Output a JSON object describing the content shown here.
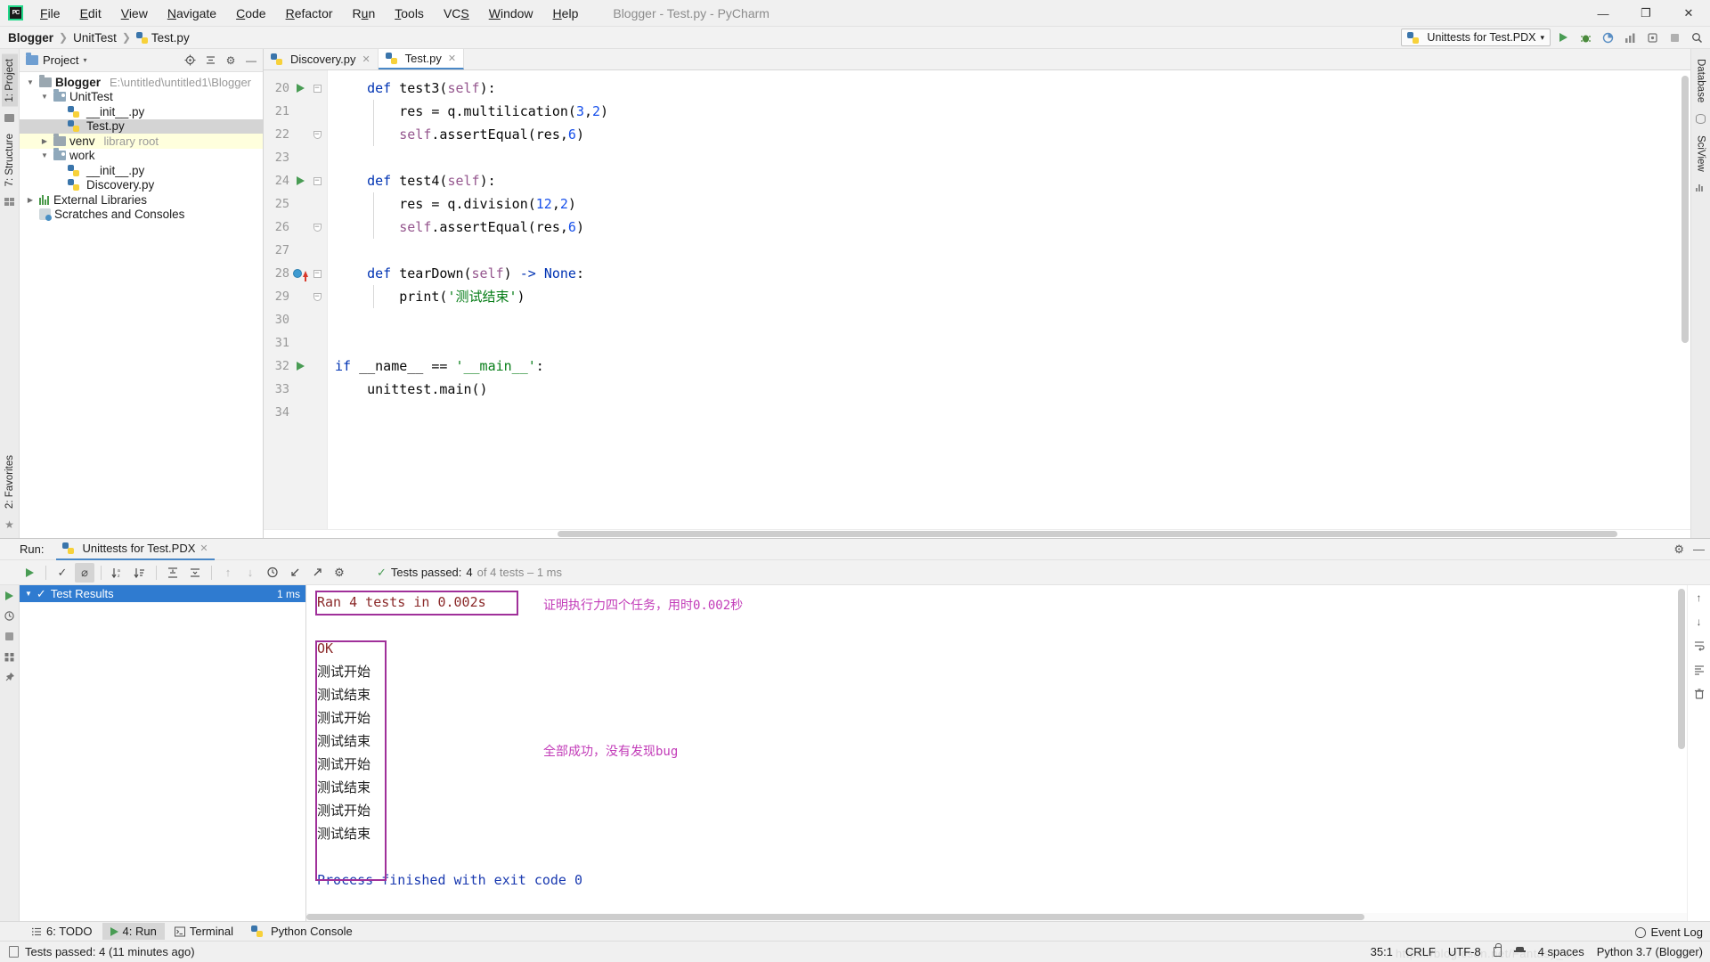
{
  "window": {
    "title": "Blogger - Test.py - PyCharm",
    "logo_text": "PC",
    "minimize": "—",
    "maximize": "❐",
    "close": "✕"
  },
  "menubar": {
    "items": [
      {
        "label": "File"
      },
      {
        "label": "Edit"
      },
      {
        "label": "View"
      },
      {
        "label": "Navigate"
      },
      {
        "label": "Code"
      },
      {
        "label": "Refactor"
      },
      {
        "label": "Run"
      },
      {
        "label": "Tools"
      },
      {
        "label": "VCS"
      },
      {
        "label": "Window"
      },
      {
        "label": "Help"
      }
    ]
  },
  "breadcrumb": {
    "items": [
      "Blogger",
      "UnitTest",
      "Test.py"
    ],
    "separator": "〉"
  },
  "run_config": {
    "name": "Unittests for Test.PDX",
    "dropdown_caret": "▾"
  },
  "nav_toolbar": {
    "run": "▶",
    "debug": "debug-icon",
    "coverage": "coverage-icon",
    "profile": "profile-icon",
    "attach": "attach-icon",
    "stop": "■",
    "search": "⌕"
  },
  "project_panel": {
    "title": "Project",
    "caret": "▾",
    "locate_icon": "⊕",
    "collapse_icon": "≡",
    "settings_icon": "⚙",
    "hide_icon": "—",
    "tree": [
      {
        "label": "Blogger",
        "sub": "E:\\untitled\\untitled1\\Blogger",
        "indent": 0,
        "twisty": "▼",
        "icon": "folder",
        "bold": true,
        "state": "none"
      },
      {
        "label": "UnitTest",
        "sub": "",
        "indent": 1,
        "twisty": "▼",
        "icon": "module",
        "bold": false,
        "state": "none"
      },
      {
        "label": "__init__.py",
        "sub": "",
        "indent": 2,
        "twisty": "",
        "icon": "python",
        "bold": false,
        "state": "none"
      },
      {
        "label": "Test.py",
        "sub": "",
        "indent": 2,
        "twisty": "",
        "icon": "python",
        "bold": false,
        "state": "selected"
      },
      {
        "label": "venv",
        "sub": "library root",
        "indent": 1,
        "twisty": "▶",
        "icon": "folder",
        "bold": false,
        "state": "highlight"
      },
      {
        "label": "work",
        "sub": "",
        "indent": 1,
        "twisty": "▼",
        "icon": "module",
        "bold": false,
        "state": "none"
      },
      {
        "label": "__init__.py",
        "sub": "",
        "indent": 2,
        "twisty": "",
        "icon": "python",
        "bold": false,
        "state": "none"
      },
      {
        "label": "Discovery.py",
        "sub": "",
        "indent": 2,
        "twisty": "",
        "icon": "python",
        "bold": false,
        "state": "none"
      },
      {
        "label": "External Libraries",
        "sub": "",
        "indent": 0,
        "twisty": "▶",
        "icon": "library",
        "bold": false,
        "state": "none"
      },
      {
        "label": "Scratches and Consoles",
        "sub": "",
        "indent": 0,
        "twisty": "",
        "icon": "scratch",
        "bold": false,
        "state": "none"
      }
    ]
  },
  "left_rail": {
    "project_tab": "1: Project",
    "structure_tab": "7: Structure",
    "favorites_tab": "2: Favorites"
  },
  "right_rail": {
    "database_tab": "Database",
    "sciview_tab": "SciView"
  },
  "editor": {
    "tabs": [
      {
        "label": "Discovery.py",
        "active": false,
        "close": "✕"
      },
      {
        "label": "Test.py",
        "active": true,
        "close": "✕"
      }
    ],
    "first_line": 20,
    "lines": [
      {
        "n": 20,
        "run": true,
        "fold": "top",
        "bp": false,
        "indent_guides": []
      },
      {
        "n": 21,
        "run": false,
        "fold": "",
        "bp": false,
        "indent_guides": [
          1
        ]
      },
      {
        "n": 22,
        "run": false,
        "fold": "bottom",
        "bp": false,
        "indent_guides": [
          1
        ]
      },
      {
        "n": 23,
        "run": false,
        "fold": "",
        "bp": false,
        "indent_guides": []
      },
      {
        "n": 24,
        "run": true,
        "fold": "top",
        "bp": false,
        "indent_guides": []
      },
      {
        "n": 25,
        "run": false,
        "fold": "",
        "bp": false,
        "indent_guides": [
          1
        ]
      },
      {
        "n": 26,
        "run": false,
        "fold": "bottom",
        "bp": false,
        "indent_guides": [
          1
        ]
      },
      {
        "n": 27,
        "run": false,
        "fold": "",
        "bp": false,
        "indent_guides": []
      },
      {
        "n": 28,
        "run": false,
        "fold": "top",
        "bp": true,
        "indent_guides": []
      },
      {
        "n": 29,
        "run": false,
        "fold": "bottom",
        "bp": false,
        "indent_guides": [
          1
        ]
      },
      {
        "n": 30,
        "run": false,
        "fold": "",
        "bp": false,
        "indent_guides": []
      },
      {
        "n": 31,
        "run": false,
        "fold": "",
        "bp": false,
        "indent_guides": []
      },
      {
        "n": 32,
        "run": true,
        "fold": "",
        "bp": false,
        "indent_guides": []
      },
      {
        "n": 33,
        "run": false,
        "fold": "",
        "bp": false,
        "indent_guides": []
      },
      {
        "n": 34,
        "run": false,
        "fold": "",
        "bp": false,
        "indent_guides": []
      }
    ],
    "code_lines": [
      "    def test3(self):",
      "        res = q.multilication(3,2)",
      "        self.assertEqual(res,6)",
      "",
      "    def test4(self):",
      "        res = q.division(12,2)",
      "        self.assertEqual(res,6)",
      "",
      "    def tearDown(self) -> None:",
      "        print('测试结束')",
      "",
      "",
      "if __name__ == '__main__':",
      "    unittest.main()",
      ""
    ]
  },
  "run_panel": {
    "label": "Run:",
    "tab_name": "Unittests for Test.PDX",
    "tab_close": "✕",
    "settings_icon": "⚙",
    "hide_icon": "—",
    "toolbar": {
      "rerun": "▶",
      "show_passed": "✓",
      "hide_ignored": "⊘",
      "sort_alpha": "↓ᵃᶻ",
      "sort_duration": "↓≣",
      "expand_all": "⤓",
      "collapse_all": "⤒",
      "prev_failed": "↑",
      "next_failed": "↓",
      "history": "⌚",
      "export": "↙",
      "open_external": "↗",
      "settings": "⚙"
    },
    "status": {
      "prefix": "Tests passed:",
      "count": "4",
      "suffix": "of 4 tests – 1 ms",
      "check": "✓"
    },
    "tree": {
      "twisty": "▼",
      "check": "✓",
      "label": "Test Results",
      "time": "1 ms"
    },
    "side_icons": [
      "history-icon",
      "stop-icon",
      "print-icon",
      "wrap-icon",
      "pin-icon"
    ],
    "right_icons": [
      "scroll-up-icon",
      "scroll-down-icon",
      "soft-wrap-icon",
      "scroll-end-icon",
      "trash-icon"
    ],
    "console": {
      "lines": [
        {
          "text": "Ran 4 tests in 0.002s",
          "style": "err"
        },
        {
          "text": "",
          "style": "plain"
        },
        {
          "text": "OK",
          "style": "err"
        },
        {
          "text": "测试开始",
          "style": "plain"
        },
        {
          "text": "测试结束",
          "style": "plain"
        },
        {
          "text": "测试开始",
          "style": "plain"
        },
        {
          "text": "测试结束",
          "style": "plain"
        },
        {
          "text": "测试开始",
          "style": "plain"
        },
        {
          "text": "测试结束",
          "style": "plain"
        },
        {
          "text": "测试开始",
          "style": "plain"
        },
        {
          "text": "测试结束",
          "style": "plain"
        },
        {
          "text": "",
          "style": "plain"
        },
        {
          "text": "Process finished with exit code 0",
          "style": "blue"
        }
      ],
      "annotations": [
        {
          "text": "证明执行力四个任务，用时0.002秒"
        },
        {
          "text": "全部成功，没有发现bug"
        }
      ]
    }
  },
  "tool_window_bar": {
    "items": [
      {
        "label": "6: TODO",
        "icon": "todo-icon",
        "active": false
      },
      {
        "label": "4: Run",
        "icon": "run-icon",
        "active": true
      },
      {
        "label": "Terminal",
        "icon": "terminal-icon",
        "active": false
      },
      {
        "label": "Python Console",
        "icon": "python-icon",
        "active": false
      }
    ]
  },
  "statusbar": {
    "message": "Tests passed: 4 (11 minutes ago)",
    "caret_position": "35:1",
    "line_separator": "CRLF",
    "encoding": "UTF-8",
    "lock_icon": "lock-icon",
    "inspection_icon": "hector-icon",
    "indent": "4 spaces",
    "interpreter": "Python 3.7 (Blogger)",
    "event_log": "Event Log",
    "watermark": "https://blog.csdn.net/Fantasy_us"
  }
}
